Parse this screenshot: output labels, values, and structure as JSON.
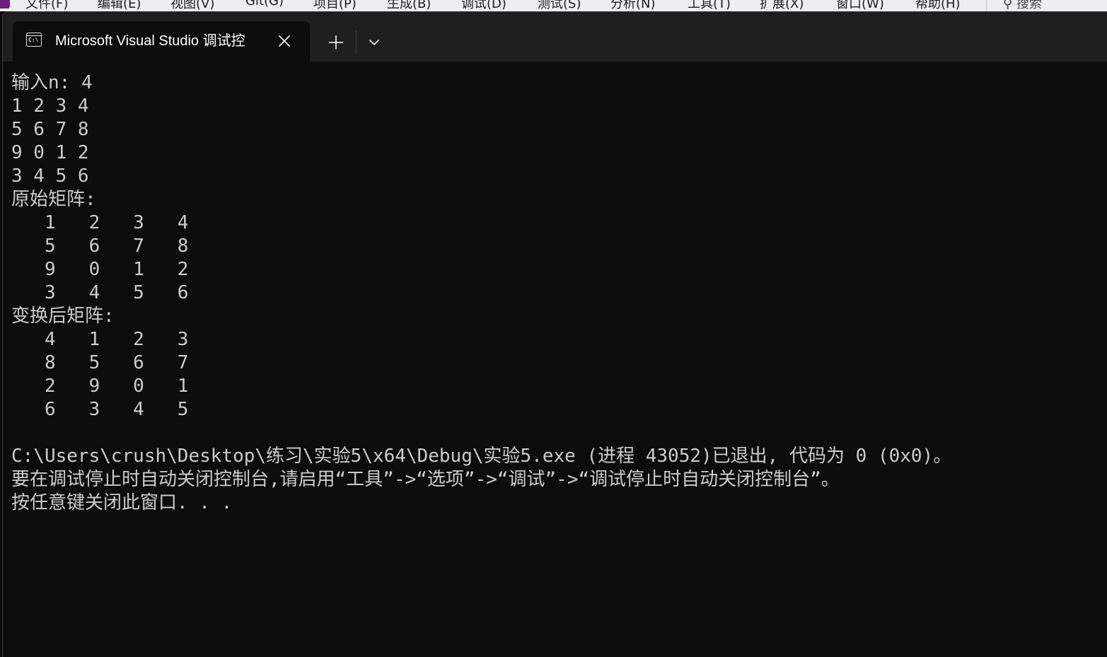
{
  "vs_menu": {
    "items": [
      "文件(F)",
      "编辑(E)",
      "视图(V)",
      "Git(G)",
      "项目(P)",
      "生成(B)",
      "调试(D)",
      "测试(S)",
      "分析(N)",
      "工具(T)",
      "扩展(X)",
      "窗口(W)",
      "帮助(H)"
    ],
    "search_label": "搜索"
  },
  "terminal": {
    "tab_title": "Microsoft Visual Studio 调试控",
    "tab_icon_text": "C:\\",
    "lines": [
      "输入n: 4",
      "1 2 3 4",
      "5 6 7 8",
      "9 0 1 2",
      "3 4 5 6",
      "原始矩阵:",
      "   1   2   3   4",
      "   5   6   7   8",
      "   9   0   1   2",
      "   3   4   5   6",
      "变换后矩阵:",
      "   4   1   2   3",
      "   8   5   6   7",
      "   2   9   0   1",
      "   6   3   4   5",
      "",
      "C:\\Users\\crush\\Desktop\\练习\\实验5\\x64\\Debug\\实验5.exe (进程 43052)已退出, 代码为 0 (0x0)。",
      "要在调试停止时自动关闭控制台,请启用“工具”->“选项”->“调试”->“调试停止时自动关闭控制台”。",
      "按任意键关闭此窗口. . ."
    ]
  }
}
